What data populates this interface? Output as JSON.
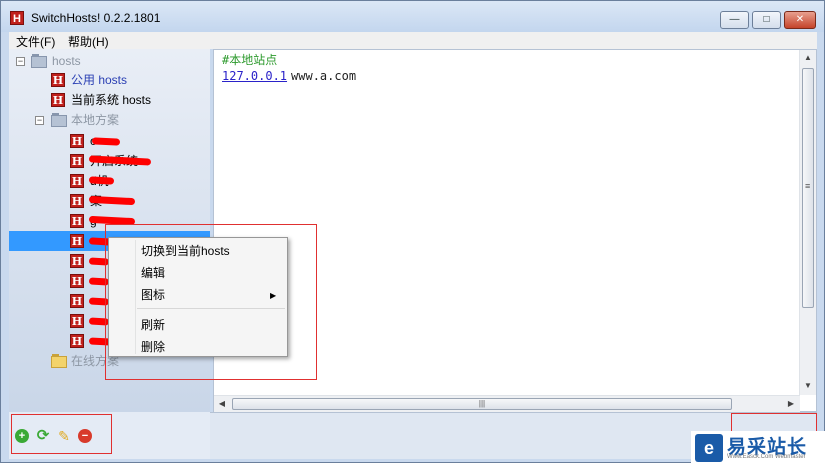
{
  "window": {
    "title": "SwitchHosts! 0.2.2.1801",
    "app_icon": "H",
    "min_glyph": "—",
    "max_glyph": "□",
    "close_glyph": "✕"
  },
  "menu": {
    "file": "文件(F)",
    "help": "帮助(H)"
  },
  "tree": {
    "root_label": "hosts",
    "public_hosts": "公用 hosts",
    "current_system": "当前系统 hosts",
    "local_group": "本地方案",
    "local_items": [
      {
        "label": "c"
      },
      {
        "label": "开启系统"
      },
      {
        "label": "d机"
      },
      {
        "label": "  案"
      },
      {
        "label": "  g"
      },
      {
        "label": ""
      },
      {
        "label": ""
      },
      {
        "label": ""
      },
      {
        "label": ""
      },
      {
        "label": ""
      },
      {
        "label": ""
      }
    ],
    "online_group": "在线方案",
    "icon_letter": "H",
    "expander_minus": "−"
  },
  "editor": {
    "line1_comment": "#本地站点",
    "line2_ip": "127.0.0.1",
    "line2_host": "www.a.com"
  },
  "scroll": {
    "up": "▲",
    "down": "▼",
    "left": "◀",
    "right": "▶",
    "vgrip": "≡",
    "hgrip": "|||"
  },
  "context_menu": {
    "items": [
      {
        "label": "切换到当前hosts"
      },
      {
        "label": "编辑"
      },
      {
        "label": "图标"
      },
      {
        "label": "刷新"
      },
      {
        "label": "删除"
      }
    ],
    "submenu_arrow": "▶"
  },
  "toolbar": {
    "add_glyph": "+",
    "refresh_glyph": "⟳",
    "edit_glyph": "✎",
    "delete_glyph": "−"
  },
  "watermark": {
    "logo": "e",
    "text": "易采站长站",
    "sub": "Www.Easck.Com Webmaster"
  },
  "colors": {
    "selection": "#3399ff",
    "annotation": "#e03030",
    "redaction": "#ff0000",
    "host_icon": "#c0201c"
  }
}
